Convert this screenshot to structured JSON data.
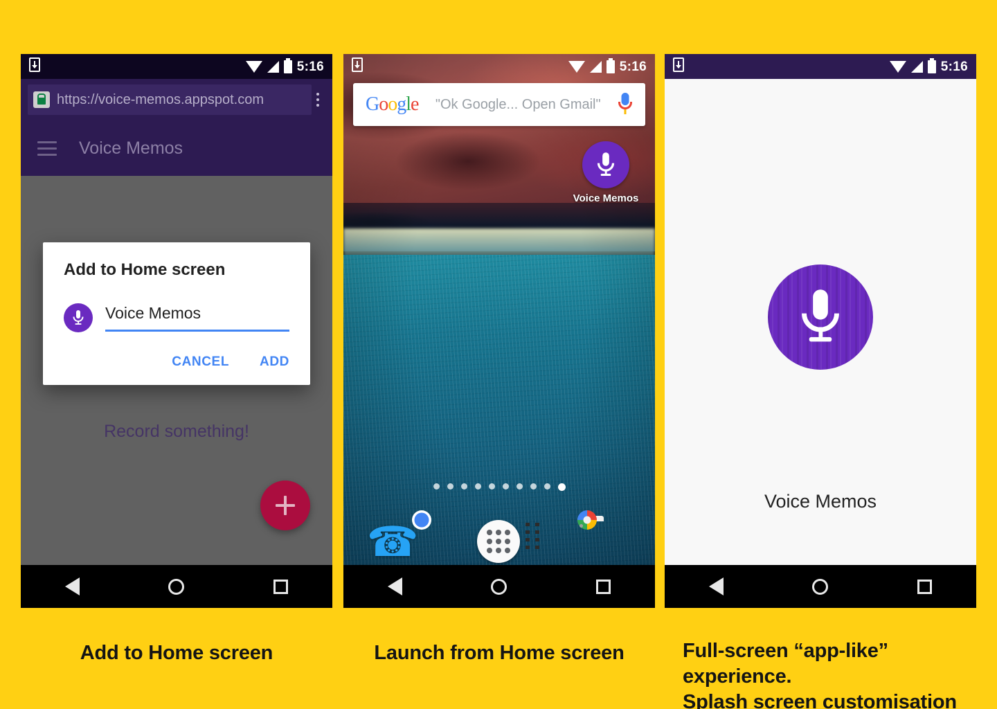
{
  "background_color": "#FFD013",
  "status_bar": {
    "time": "5:16",
    "icons": [
      "save-to-device-icon",
      "wifi-icon",
      "signal-icon",
      "battery-icon"
    ]
  },
  "nav_bar": {
    "back": "back-icon",
    "home": "home-icon",
    "recents": "recents-icon"
  },
  "phone1": {
    "browser": {
      "url": "https://voice-memos.appspot.com",
      "lock_icon": "secure-lock-icon",
      "menu_icon": "overflow-menu-icon",
      "chrome_color": "#2d1b52"
    },
    "appbar": {
      "menu_icon": "hamburger-menu-icon",
      "title": "Voice Memos"
    },
    "content": {
      "empty_state": "Record something!",
      "fab_icon": "plus-icon",
      "fab_color": "#ab0d3f",
      "scrim_color": "#616161"
    },
    "dialog": {
      "title": "Add to Home screen",
      "icon": "microphone-icon",
      "shortcut_name": "Voice Memos",
      "cancel_label": "CANCEL",
      "add_label": "ADD",
      "action_color": "#4285f4"
    }
  },
  "phone2": {
    "search_widget": {
      "logo": [
        "G",
        "o",
        "o",
        "g",
        "l",
        "e"
      ],
      "hint": "\"Ok Google... Open Gmail\"",
      "mic_icon": "voice-search-mic-icon"
    },
    "home_shortcut": {
      "label": "Voice Memos",
      "icon": "microphone-icon",
      "icon_color": "#6a2ac0"
    },
    "page_indicator": {
      "total": 10,
      "active_index": 9
    },
    "dock": [
      {
        "name": "phone-app",
        "icon": "phone-icon"
      },
      {
        "name": "chrome-app",
        "icon": "chrome-icon"
      },
      {
        "name": "app-drawer",
        "icon": "app-drawer-icon"
      },
      {
        "name": "play-movies-app",
        "icon": "movies-icon"
      },
      {
        "name": "camera-app",
        "icon": "camera-icon"
      }
    ]
  },
  "phone3": {
    "splash": {
      "icon": "microphone-icon",
      "icon_color": "#6a2ac0",
      "app_name": "Voice Memos",
      "background": "#f8f8f8"
    }
  },
  "captions": {
    "one": "Add to Home screen",
    "two": "Launch from Home screen",
    "three_line1": "Full-screen “app-like” experience.",
    "three_line2": "Splash screen customisation"
  }
}
